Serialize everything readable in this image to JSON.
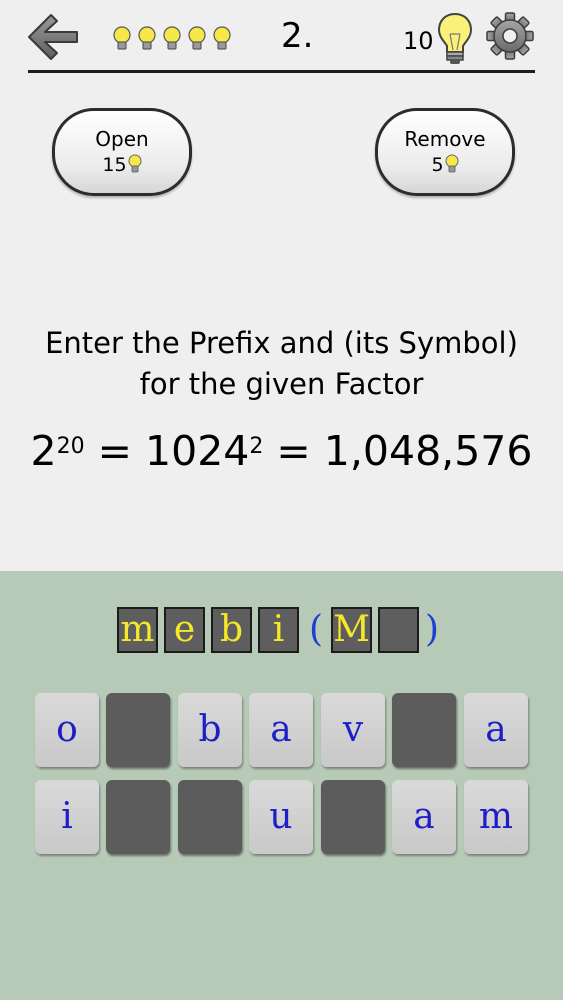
{
  "header": {
    "level": "2.",
    "hint_count": "10",
    "lives_count": 5
  },
  "hints": {
    "open_label": "Open",
    "open_cost": "15",
    "remove_label": "Remove",
    "remove_cost": "5"
  },
  "question": {
    "line1": "Enter the Prefix and (its Symbol)",
    "line2": "for the given Factor",
    "formula": {
      "base1": "2",
      "exp1": "20",
      "eq1": " = ",
      "base2": "1024",
      "exp2": "2",
      "eq2": " = ",
      "result": "1,048,576"
    }
  },
  "answer": {
    "word": [
      "m",
      "e",
      "b",
      "i"
    ],
    "open_paren": "(",
    "symbol": [
      "M",
      ""
    ],
    "close_paren": ")"
  },
  "keyboard": {
    "row1": [
      {
        "letter": "o",
        "used": false
      },
      {
        "letter": "",
        "used": true
      },
      {
        "letter": "b",
        "used": false
      },
      {
        "letter": "a",
        "used": false
      },
      {
        "letter": "v",
        "used": false
      },
      {
        "letter": "",
        "used": true
      },
      {
        "letter": "a",
        "used": false
      }
    ],
    "row2": [
      {
        "letter": "i",
        "used": false
      },
      {
        "letter": "",
        "used": true
      },
      {
        "letter": "",
        "used": true
      },
      {
        "letter": "u",
        "used": false
      },
      {
        "letter": "",
        "used": true
      },
      {
        "letter": "a",
        "used": false
      },
      {
        "letter": "m",
        "used": false
      }
    ]
  },
  "colors": {
    "bulb": "#f7e84a",
    "pane": "#b7cab7",
    "slot_text": "#f5e82a",
    "key_text": "#1e1ec8",
    "paren": "#1b3fd6"
  },
  "icons": [
    "back-arrow-icon",
    "lightbulb-icon",
    "gear-icon"
  ]
}
